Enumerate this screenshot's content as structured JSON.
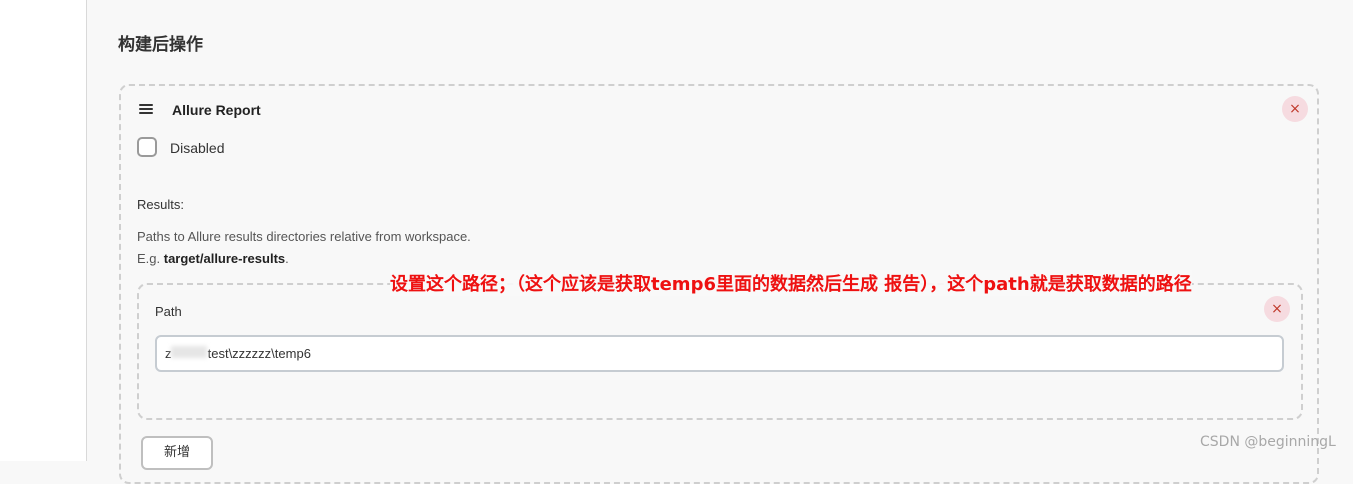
{
  "section": {
    "title": "构建后操作"
  },
  "step": {
    "title": "Allure Report",
    "drag_icon": "drag-handle-icon",
    "close_icon": "close-icon",
    "close_glyph": "×",
    "disabled_label": "Disabled",
    "disabled_checked": false
  },
  "results": {
    "label": "Results:",
    "help_line1": "Paths to Allure results directories relative from workspace.",
    "help_prefix": "E.g. ",
    "help_example": "target/allure-results",
    "help_suffix": "."
  },
  "path": {
    "label": "Path",
    "value": "z          test\\zzzzzz\\temp6",
    "close_glyph": "×"
  },
  "add_button": {
    "label": "新增"
  },
  "annotation": {
    "text": "设置这个路径；（这个应该是获取temp6里面的数据然后生成 报告），这个path就是获取数据的路径"
  },
  "watermark": {
    "text": "CSDN @beginningL"
  },
  "colors": {
    "annotation": "#ee1111",
    "close_bg": "#f6dbe0",
    "close_fg": "#c0392b",
    "background": "#f8f8f8"
  }
}
